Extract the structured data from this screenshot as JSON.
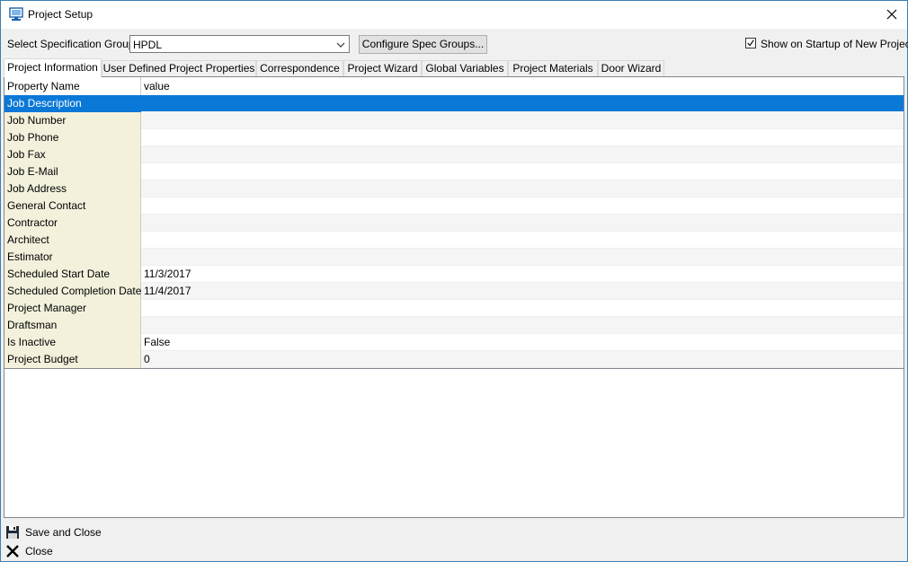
{
  "window": {
    "title": "Project Setup"
  },
  "spec": {
    "label": "Select Specification Group",
    "selected": "HPDL",
    "configure_button": "Configure Spec Groups...",
    "startup_checkbox_label": "Show on Startup of New Project",
    "startup_checked": true
  },
  "tabs": [
    {
      "label": "Project Information",
      "active": true
    },
    {
      "label": "User Defined Project Properties"
    },
    {
      "label": "Correspondence"
    },
    {
      "label": "Project Wizard"
    },
    {
      "label": "Global Variables"
    },
    {
      "label": "Project Materials"
    },
    {
      "label": "Door Wizard"
    }
  ],
  "grid": {
    "headers": {
      "name": "Property Name",
      "value": "value"
    },
    "rows": [
      {
        "name": "Job Description",
        "value": ""
      },
      {
        "name": "Job Number",
        "value": ""
      },
      {
        "name": "Job Phone",
        "value": ""
      },
      {
        "name": "Job Fax",
        "value": ""
      },
      {
        "name": "Job E-Mail",
        "value": ""
      },
      {
        "name": "Job Address",
        "value": ""
      },
      {
        "name": "General Contact",
        "value": ""
      },
      {
        "name": "Contractor",
        "value": ""
      },
      {
        "name": "Architect",
        "value": ""
      },
      {
        "name": "Estimator",
        "value": ""
      },
      {
        "name": "Scheduled Start Date",
        "value": "11/3/2017"
      },
      {
        "name": "Scheduled Completion Date",
        "value": "11/4/2017"
      },
      {
        "name": "Project Manager",
        "value": ""
      },
      {
        "name": "Draftsman",
        "value": ""
      },
      {
        "name": "Is Inactive",
        "value": "False"
      },
      {
        "name": "Project Budget",
        "value": "0"
      }
    ]
  },
  "actions": {
    "save_close": "Save and Close",
    "close": "Close"
  },
  "icons": {
    "title": "project-setup-icon",
    "close": "close-icon",
    "save": "floppy-disk-icon",
    "close_action": "x-icon"
  },
  "colors": {
    "selection": "#0a78d7",
    "name_column": "#f3f1dc",
    "window_border": "#3c7fb1"
  }
}
